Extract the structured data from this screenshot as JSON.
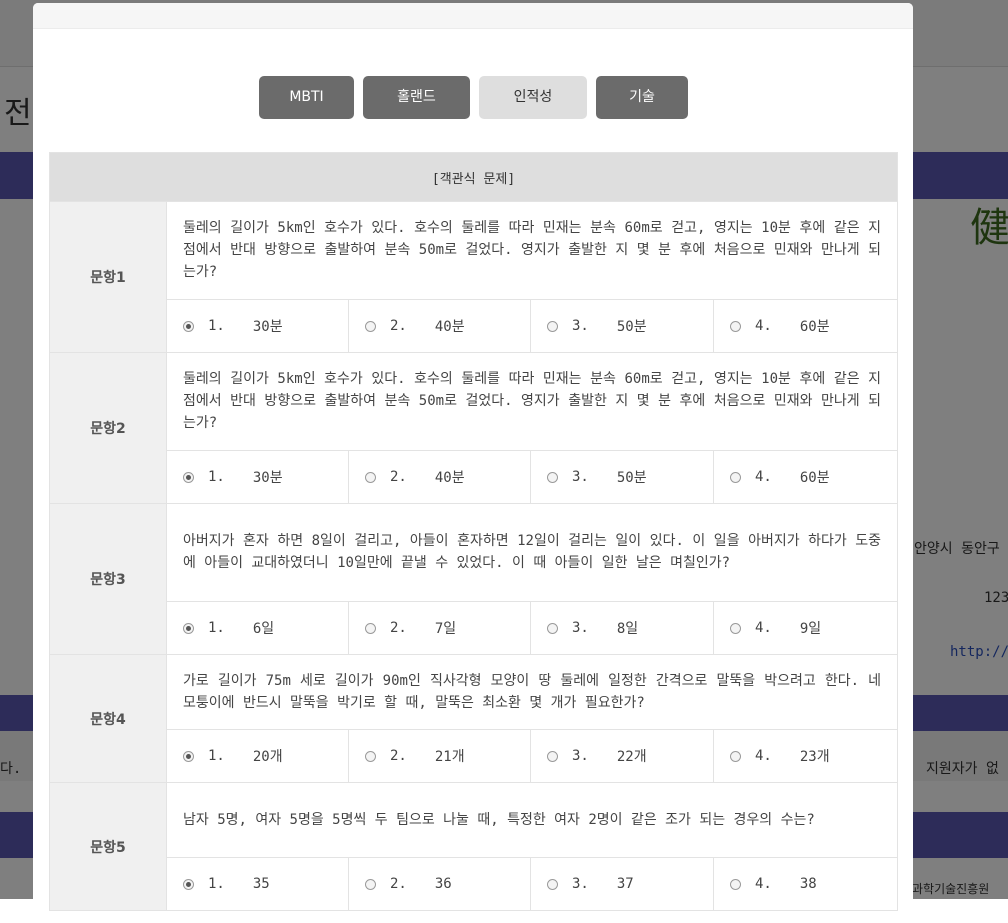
{
  "background": {
    "partial_heading": "전",
    "right_text_1": "안양시 동안구",
    "right_text_2": "123",
    "right_text_3": "http://",
    "left_text": "다.",
    "right_text_4": "지원자가 없",
    "right_text_5": "과학기술진흥원"
  },
  "tabs": [
    {
      "label": "MBTI",
      "active": false
    },
    {
      "label": "홀랜드",
      "active": false
    },
    {
      "label": "인적성",
      "active": true
    },
    {
      "label": "기술",
      "active": false
    }
  ],
  "section_title": "[객관식 문제]",
  "questions": [
    {
      "label": "문항1",
      "text": "둘레의 길이가 5km인 호수가 있다. 호수의 둘레를 따라 민재는 분속 60m로 걷고, 영지는 10분 후에 같은 지점에서 반대 방향으로 출발하여 분속 50m로 걸었다. 영지가 출발한 지 몇 분 후에 처음으로 민재와 만나게 되는가?",
      "options": [
        {
          "num": "1.",
          "text": "30분"
        },
        {
          "num": "2.",
          "text": "40분"
        },
        {
          "num": "3.",
          "text": "50분"
        },
        {
          "num": "4.",
          "text": "60분"
        }
      ],
      "selected": 0
    },
    {
      "label": "문항2",
      "text": "둘레의 길이가 5km인 호수가 있다. 호수의 둘레를 따라 민재는 분속 60m로 걷고, 영지는 10분 후에 같은 지점에서 반대 방향으로 출발하여 분속 50m로 걸었다. 영지가 출발한 지 몇 분 후에 처음으로 민재와 만나게 되는가?",
      "options": [
        {
          "num": "1.",
          "text": "30분"
        },
        {
          "num": "2.",
          "text": "40분"
        },
        {
          "num": "3.",
          "text": "50분"
        },
        {
          "num": "4.",
          "text": "60분"
        }
      ],
      "selected": 0
    },
    {
      "label": "문항3",
      "text": "아버지가 혼자 하면 8일이 걸리고, 아들이 혼자하면 12일이 걸리는 일이 있다. 이 일을 아버지가 하다가 도중에 아들이 교대하였더니 10일만에 끝낼 수 있었다. 이 때 아들이 일한 날은 며칠인가?",
      "options": [
        {
          "num": "1.",
          "text": "6일"
        },
        {
          "num": "2.",
          "text": "7일"
        },
        {
          "num": "3.",
          "text": "8일"
        },
        {
          "num": "4.",
          "text": "9일"
        }
      ],
      "selected": 0
    },
    {
      "label": "문항4",
      "text": "가로 길이가 75m 세로 길이가 90m인 직사각형 모양이 땅 둘레에 일정한 간격으로 말뚝을 박으려고 한다. 네 모퉁이에 반드시 말뚝을 박기로 할 때, 말뚝은 최소환 몇 개가 필요한가?",
      "options": [
        {
          "num": "1.",
          "text": "20개"
        },
        {
          "num": "2.",
          "text": "21개"
        },
        {
          "num": "3.",
          "text": "22개"
        },
        {
          "num": "4.",
          "text": "23개"
        }
      ],
      "selected": 0
    },
    {
      "label": "문항5",
      "text": "남자 5명, 여자 5명을 5명씩 두 팀으로 나눌 때, 특정한 여자 2명이 같은 조가 되는 경우의 수는?",
      "options": [
        {
          "num": "1.",
          "text": "35"
        },
        {
          "num": "2.",
          "text": "36"
        },
        {
          "num": "3.",
          "text": "37"
        },
        {
          "num": "4.",
          "text": "38"
        }
      ],
      "selected": 0
    }
  ]
}
